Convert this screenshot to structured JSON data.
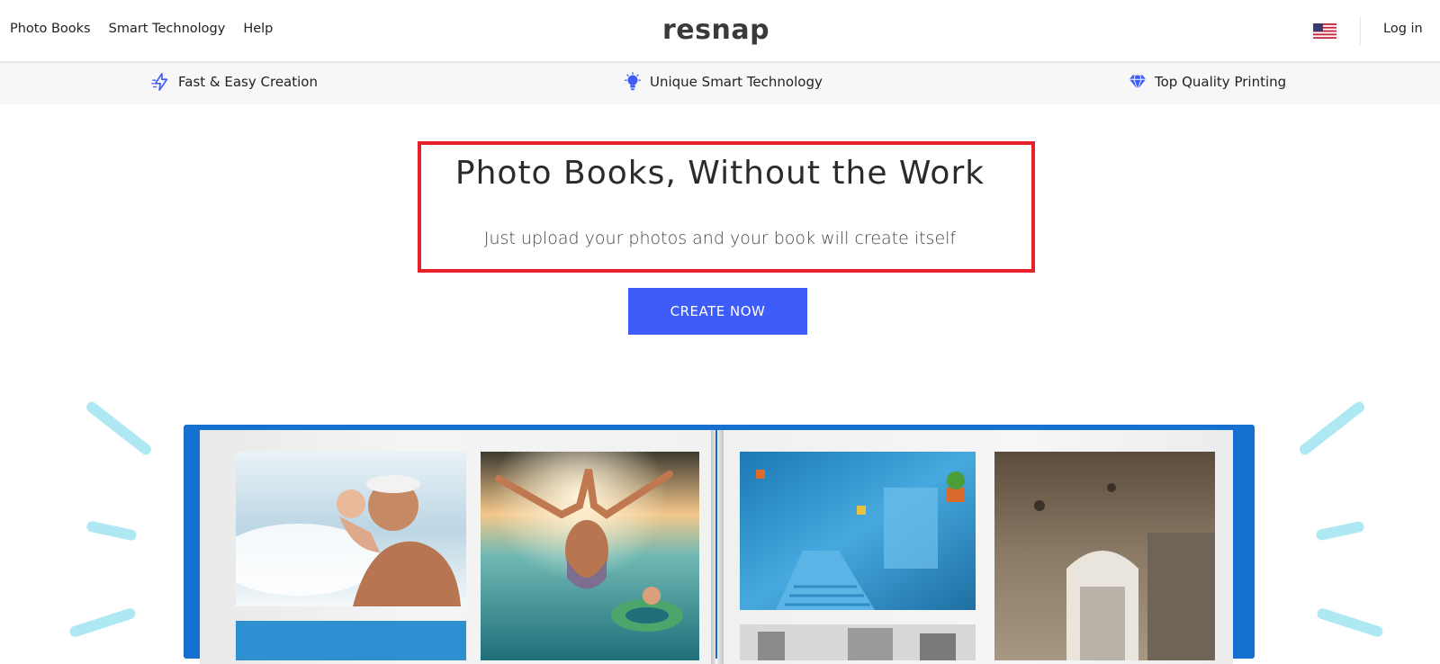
{
  "nav": {
    "links": [
      "Photo Books",
      "Smart Technology",
      "Help"
    ],
    "logo": "resnap",
    "flag_icon": "us-flag-icon",
    "login_label": "Log in"
  },
  "features": [
    {
      "icon": "lightning-icon",
      "label": "Fast & Easy Creation"
    },
    {
      "icon": "lightbulb-icon",
      "label": "Unique Smart Technology"
    },
    {
      "icon": "diamond-icon",
      "label": "Top Quality Printing"
    }
  ],
  "hero": {
    "title": "Photo Books, Without the Work",
    "subtitle": "Just upload your photos and your book will create itself",
    "cta_label": "CREATE NOW"
  },
  "colors": {
    "accent": "#3e5cf9",
    "highlight_border": "#e8202a",
    "book_cover": "#1670d0",
    "sparkle": "#aee9f3"
  }
}
